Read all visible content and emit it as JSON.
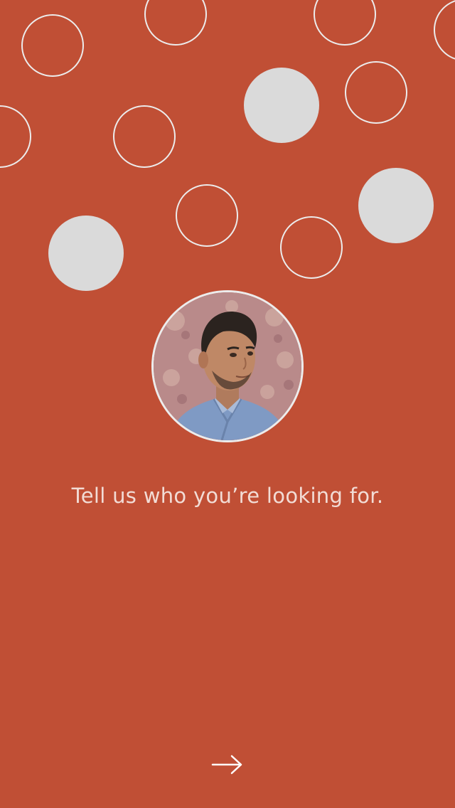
{
  "screen": {
    "background_color": "#c04f35",
    "bubble_outline_color": "#ececec",
    "bubble_fill_color": "#dadada"
  },
  "profile": {
    "avatar": "user-avatar-photo"
  },
  "prompt": {
    "text": "Tell us who you’re looking for."
  },
  "navigation": {
    "next_icon": "arrow-right-icon"
  }
}
